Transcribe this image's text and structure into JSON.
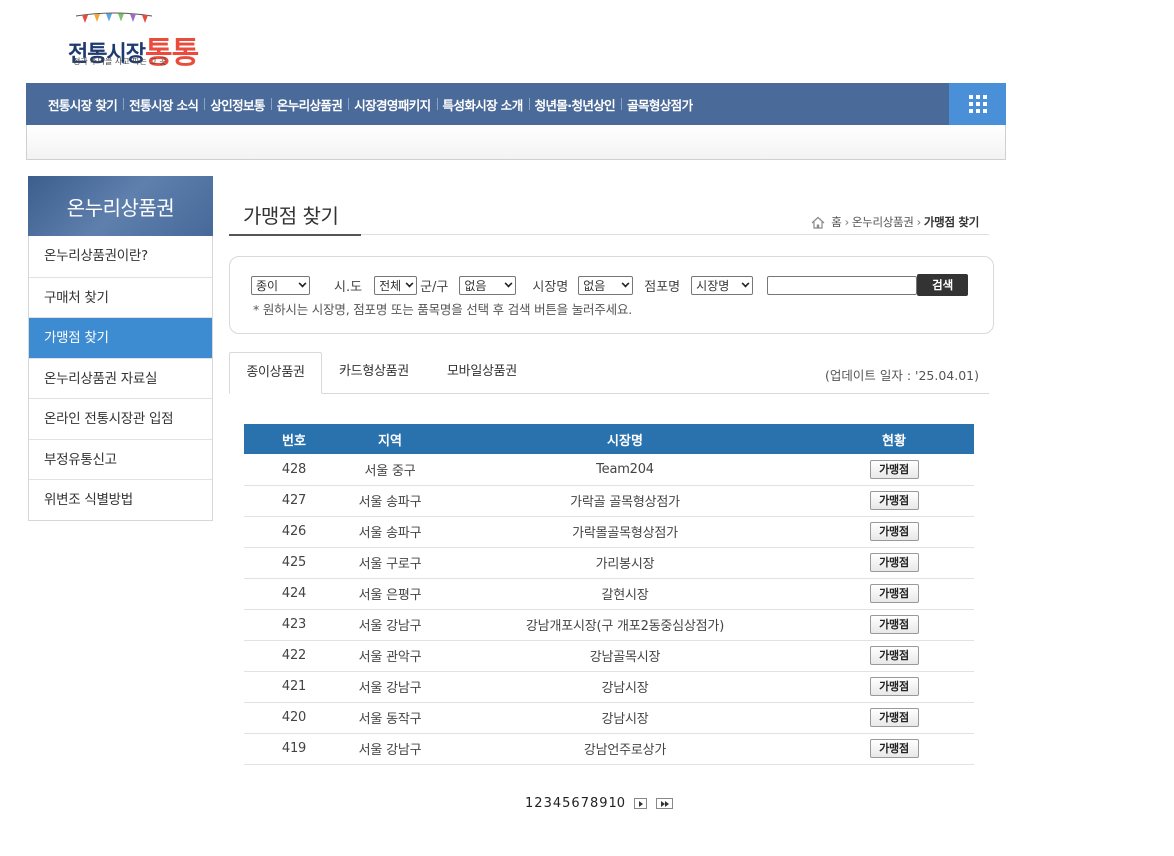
{
  "logo": {
    "main_text": "전통시장",
    "brand_text": "통통",
    "tagline": "정과 추억을 사고 파는 그 곳"
  },
  "gnb": {
    "items": [
      "전통시장 찾기",
      "전통시장 소식",
      "상인정보통",
      "온누리상품권",
      "시장경영패키지",
      "특성화시장 소개",
      "청년몰·청년상인",
      "골목형상점가"
    ],
    "colors": {
      "bar": "#4a6a99",
      "allmenu": "#4a90d9"
    }
  },
  "lnb": {
    "title": "온누리상품권",
    "items": [
      "온누리상품권이란?",
      "구매처 찾기",
      "가맹점 찾기",
      "온누리상품권 자료실",
      "온라인 전통시장관 입점",
      "부정유통신고",
      "위변조 식별방법"
    ],
    "active_index": 2
  },
  "page": {
    "title": "가맹점 찾기",
    "breadcrumb": [
      "홈",
      "온누리상품권",
      "가맹점 찾기"
    ]
  },
  "search": {
    "type_value": "종이",
    "sido_label": "시.도",
    "sido_value": "전체",
    "gungu_label": "군/구",
    "gungu_value": "없음",
    "market_label": "시장명",
    "market_value": "없음",
    "store_label": "점포명",
    "store_value": "시장명",
    "keyword_value": "",
    "button_label": "검색",
    "hint": "* 원하시는 시장명, 점포명 또는 품목명을 선택 후 검색 버튼을 눌러주세요."
  },
  "tabs": {
    "items": [
      "종이상품권",
      "카드형상품권",
      "모바일상품권"
    ],
    "active_index": 0,
    "update_date": "(업데이트 일자 : '25.04.01)"
  },
  "table": {
    "headers": [
      "번호",
      "지역",
      "시장명",
      "현황"
    ],
    "button_label": "가맹점",
    "rows": [
      {
        "no": "428",
        "region": "서울 중구",
        "market": "Team204"
      },
      {
        "no": "427",
        "region": "서울 송파구",
        "market": "가락골 골목형상점가"
      },
      {
        "no": "426",
        "region": "서울 송파구",
        "market": "가락몰골목형상점가"
      },
      {
        "no": "425",
        "region": "서울 구로구",
        "market": "가리봉시장"
      },
      {
        "no": "424",
        "region": "서울 은평구",
        "market": "갈현시장"
      },
      {
        "no": "423",
        "region": "서울 강남구",
        "market": "강남개포시장(구 개포2동중심상점가)"
      },
      {
        "no": "422",
        "region": "서울 관악구",
        "market": "강남골목시장"
      },
      {
        "no": "421",
        "region": "서울 강남구",
        "market": "강남시장"
      },
      {
        "no": "420",
        "region": "서울 동작구",
        "market": "강남시장"
      },
      {
        "no": "419",
        "region": "서울 강남구",
        "market": "강남언주로상가"
      }
    ]
  },
  "paging": {
    "pages": [
      "1",
      "2",
      "3",
      "4",
      "5",
      "6",
      "7",
      "8",
      "9",
      "10"
    ]
  }
}
